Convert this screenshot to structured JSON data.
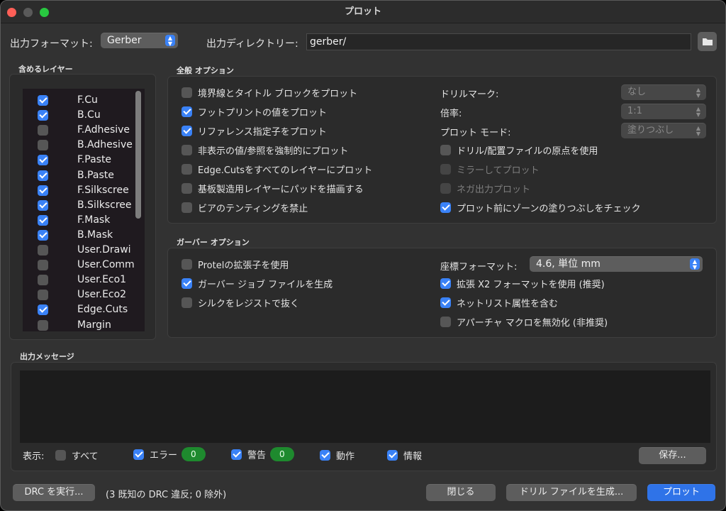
{
  "window": {
    "title": "プロット"
  },
  "colors": {
    "accent": "#3a82f7",
    "badge": "#1e8a2e",
    "close": "#fe5f57",
    "maximize": "#28c840"
  },
  "top": {
    "format_label": "出力フォーマット:",
    "format_value": "Gerber",
    "dir_label": "出力ディレクトリー:",
    "dir_value": "gerber/",
    "folder_icon": "folder-icon"
  },
  "layers": {
    "title": "含めるレイヤー",
    "items": [
      {
        "name": "F.Cu",
        "checked": true
      },
      {
        "name": "B.Cu",
        "checked": true
      },
      {
        "name": "F.Adhesive",
        "checked": false
      },
      {
        "name": "B.Adhesive",
        "checked": false
      },
      {
        "name": "F.Paste",
        "checked": true
      },
      {
        "name": "B.Paste",
        "checked": true
      },
      {
        "name": "F.Silkscree",
        "checked": true
      },
      {
        "name": "B.Silkscree",
        "checked": true
      },
      {
        "name": "F.Mask",
        "checked": true
      },
      {
        "name": "B.Mask",
        "checked": true
      },
      {
        "name": "User.Drawi",
        "checked": false
      },
      {
        "name": "User.Comm",
        "checked": false
      },
      {
        "name": "User.Eco1",
        "checked": false
      },
      {
        "name": "User.Eco2",
        "checked": false
      },
      {
        "name": "Edge.Cuts",
        "checked": true
      },
      {
        "name": "Margin",
        "checked": false
      }
    ]
  },
  "general": {
    "title": "全般 オプション",
    "left": [
      {
        "label": "境界線とタイトル ブロックをプロット",
        "checked": false
      },
      {
        "label": "フットプリントの値をプロット",
        "checked": true
      },
      {
        "label": "リファレンス指定子をプロット",
        "checked": true
      },
      {
        "label": "非表示の値/参照を強制的にプロット",
        "checked": false
      },
      {
        "label": "Edge.Cutsをすべてのレイヤーにプロット",
        "checked": false
      },
      {
        "label": "基板製造用レイヤーにパッドを描画する",
        "checked": false
      },
      {
        "label": "ビアのテンティングを禁止",
        "checked": false
      }
    ],
    "drill_mark_label": "ドリルマーク:",
    "drill_mark_value": "なし",
    "scale_label": "倍率:",
    "scale_value": "1:1",
    "plot_mode_label": "プロット モード:",
    "plot_mode_value": "塗りつぶし",
    "right": [
      {
        "label": "ドリル/配置ファイルの原点を使用",
        "checked": false,
        "disabled": false
      },
      {
        "label": "ミラーしてプロット",
        "checked": false,
        "disabled": true
      },
      {
        "label": "ネガ出力プロット",
        "checked": false,
        "disabled": true
      },
      {
        "label": "プロット前にゾーンの塗りつぶしをチェック",
        "checked": true,
        "disabled": false
      }
    ]
  },
  "gerber": {
    "title": "ガーバー オプション",
    "left": [
      {
        "label": "Protelの拡張子を使用",
        "checked": false
      },
      {
        "label": "ガーバー ジョブ ファイルを生成",
        "checked": true
      },
      {
        "label": "シルクをレジストで抜く",
        "checked": false
      }
    ],
    "coord_label": "座標フォーマット:",
    "coord_value": "4.6, 単位 mm",
    "right": [
      {
        "label": "拡張 X2 フォーマットを使用 (推奨)",
        "checked": true
      },
      {
        "label": "ネットリスト属性を含む",
        "checked": true
      },
      {
        "label": "アパーチャ マクロを無効化 (非推奨)",
        "checked": false
      }
    ]
  },
  "messages": {
    "title": "出力メッセージ",
    "show_label": "表示:",
    "all_label": "すべて",
    "error_label": "エラー",
    "error_count": "0",
    "warning_label": "警告",
    "warning_count": "0",
    "action_label": "動作",
    "info_label": "情報",
    "save_label": "保存..."
  },
  "bottom": {
    "drc_label": "DRC を実行...",
    "drc_status": "(3 既知の DRC 違反; 0 除外)",
    "close_label": "閉じる",
    "drill_label": "ドリル ファイルを生成...",
    "plot_label": "プロット"
  }
}
